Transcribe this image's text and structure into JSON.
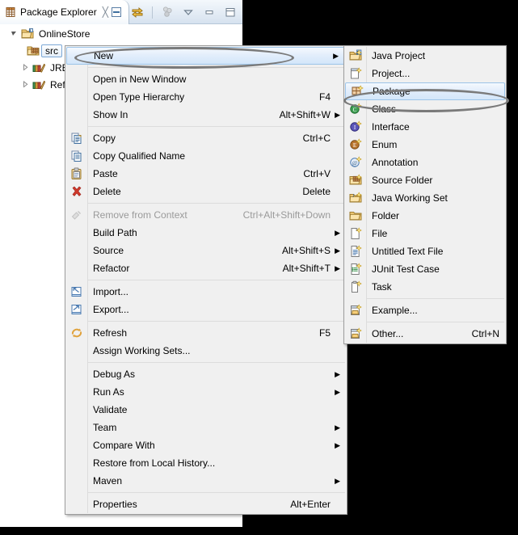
{
  "view": {
    "tab": {
      "title": "Package Explorer",
      "icon": "package-explorer-icon",
      "close": "╳"
    },
    "toolbar": [
      {
        "name": "collapse-all-icon",
        "title": "Collapse All"
      },
      {
        "name": "link-with-editor-icon",
        "title": "Link with Editor"
      },
      {
        "name": "view-menu-icon",
        "title": "View Menu"
      },
      {
        "name": "chevron-down-icon",
        "title": "Minimize Group"
      },
      {
        "name": "minimize-icon",
        "title": "Minimize"
      },
      {
        "name": "maximize-icon",
        "title": "Maximize"
      }
    ],
    "tree": [
      {
        "label": "OnlineStore",
        "icon": "java-project-icon",
        "depth": 0,
        "expanded": true,
        "selected": false
      },
      {
        "label": "src",
        "icon": "source-folder-icon",
        "depth": 1,
        "expanded": null,
        "selected": true
      },
      {
        "label": "JRE",
        "icon": "library-icon",
        "depth": 1,
        "expanded": false,
        "selected": false
      },
      {
        "label": "Ref",
        "icon": "library-icon",
        "depth": 1,
        "expanded": false,
        "selected": false
      }
    ]
  },
  "context_menu": {
    "items": [
      {
        "label": "New",
        "accel": "",
        "icon": "",
        "arrow": true,
        "highlighted": true,
        "disabled": false
      },
      {
        "separator": true
      },
      {
        "label": "Open in New Window",
        "accel": "",
        "icon": "",
        "arrow": false,
        "highlighted": false,
        "disabled": false
      },
      {
        "label": "Open Type Hierarchy",
        "accel": "F4",
        "icon": "",
        "arrow": false,
        "highlighted": false,
        "disabled": false
      },
      {
        "label": "Show In",
        "accel": "Alt+Shift+W",
        "icon": "",
        "arrow": true,
        "highlighted": false,
        "disabled": false
      },
      {
        "separator": true
      },
      {
        "label": "Copy",
        "accel": "Ctrl+C",
        "icon": "copy-icon",
        "arrow": false,
        "highlighted": false,
        "disabled": false
      },
      {
        "label": "Copy Qualified Name",
        "accel": "",
        "icon": "copy-qualified-name-icon",
        "arrow": false,
        "highlighted": false,
        "disabled": false
      },
      {
        "label": "Paste",
        "accel": "Ctrl+V",
        "icon": "paste-icon",
        "arrow": false,
        "highlighted": false,
        "disabled": false
      },
      {
        "label": "Delete",
        "accel": "Delete",
        "icon": "delete-icon",
        "arrow": false,
        "highlighted": false,
        "disabled": false
      },
      {
        "separator": true
      },
      {
        "label": "Remove from Context",
        "accel": "Ctrl+Alt+Shift+Down",
        "icon": "remove-from-context-icon",
        "arrow": false,
        "highlighted": false,
        "disabled": true
      },
      {
        "label": "Build Path",
        "accel": "",
        "icon": "",
        "arrow": true,
        "highlighted": false,
        "disabled": false
      },
      {
        "label": "Source",
        "accel": "Alt+Shift+S",
        "icon": "",
        "arrow": true,
        "highlighted": false,
        "disabled": false
      },
      {
        "label": "Refactor",
        "accel": "Alt+Shift+T",
        "icon": "",
        "arrow": true,
        "highlighted": false,
        "disabled": false
      },
      {
        "separator": true
      },
      {
        "label": "Import...",
        "accel": "",
        "icon": "import-icon",
        "arrow": false,
        "highlighted": false,
        "disabled": false
      },
      {
        "label": "Export...",
        "accel": "",
        "icon": "export-icon",
        "arrow": false,
        "highlighted": false,
        "disabled": false
      },
      {
        "separator": true
      },
      {
        "label": "Refresh",
        "accel": "F5",
        "icon": "refresh-icon",
        "arrow": false,
        "highlighted": false,
        "disabled": false
      },
      {
        "label": "Assign Working Sets...",
        "accel": "",
        "icon": "",
        "arrow": false,
        "highlighted": false,
        "disabled": false
      },
      {
        "separator": true
      },
      {
        "label": "Debug As",
        "accel": "",
        "icon": "",
        "arrow": true,
        "highlighted": false,
        "disabled": false
      },
      {
        "label": "Run As",
        "accel": "",
        "icon": "",
        "arrow": true,
        "highlighted": false,
        "disabled": false
      },
      {
        "label": "Validate",
        "accel": "",
        "icon": "",
        "arrow": false,
        "highlighted": false,
        "disabled": false
      },
      {
        "label": "Team",
        "accel": "",
        "icon": "",
        "arrow": true,
        "highlighted": false,
        "disabled": false
      },
      {
        "label": "Compare With",
        "accel": "",
        "icon": "",
        "arrow": true,
        "highlighted": false,
        "disabled": false
      },
      {
        "label": "Restore from Local History...",
        "accel": "",
        "icon": "",
        "arrow": false,
        "highlighted": false,
        "disabled": false
      },
      {
        "label": "Maven",
        "accel": "",
        "icon": "",
        "arrow": true,
        "highlighted": false,
        "disabled": false
      },
      {
        "separator": true
      },
      {
        "label": "Properties",
        "accel": "Alt+Enter",
        "icon": "",
        "arrow": false,
        "highlighted": false,
        "disabled": false
      }
    ]
  },
  "new_submenu": {
    "items": [
      {
        "label": "Java Project",
        "accel": "",
        "icon": "java-project-icon",
        "highlighted": false
      },
      {
        "label": "Project...",
        "accel": "",
        "icon": "project-icon",
        "highlighted": false
      },
      {
        "label": "Package",
        "accel": "",
        "icon": "package-icon",
        "highlighted": true
      },
      {
        "label": "Class",
        "accel": "",
        "icon": "class-icon",
        "highlighted": false
      },
      {
        "label": "Interface",
        "accel": "",
        "icon": "interface-icon",
        "highlighted": false
      },
      {
        "label": "Enum",
        "accel": "",
        "icon": "enum-icon",
        "highlighted": false
      },
      {
        "label": "Annotation",
        "accel": "",
        "icon": "annotation-icon",
        "highlighted": false
      },
      {
        "label": "Source Folder",
        "accel": "",
        "icon": "source-folder-icon",
        "highlighted": false
      },
      {
        "label": "Java Working Set",
        "accel": "",
        "icon": "java-working-set-icon",
        "highlighted": false
      },
      {
        "label": "Folder",
        "accel": "",
        "icon": "folder-icon",
        "highlighted": false
      },
      {
        "label": "File",
        "accel": "",
        "icon": "file-icon",
        "highlighted": false
      },
      {
        "label": "Untitled Text File",
        "accel": "",
        "icon": "text-file-icon",
        "highlighted": false
      },
      {
        "label": "JUnit Test Case",
        "accel": "",
        "icon": "junit-test-case-icon",
        "highlighted": false
      },
      {
        "label": "Task",
        "accel": "",
        "icon": "task-icon",
        "highlighted": false
      },
      {
        "separator": true
      },
      {
        "label": "Example...",
        "accel": "",
        "icon": "example-icon",
        "highlighted": false
      },
      {
        "separator": true
      },
      {
        "label": "Other...",
        "accel": "Ctrl+N",
        "icon": "other-icon",
        "highlighted": false
      }
    ]
  },
  "annotations": [
    {
      "name": "highlight-oval-new",
      "target": "New"
    },
    {
      "name": "highlight-oval-package",
      "target": "Package"
    }
  ],
  "colors": {
    "menu_bg": "#f0f0f0",
    "menu_border": "#9d9d9d",
    "highlight_border": "#9cc4e8",
    "annotation": "#7a7a7a",
    "disabled_text": "#9a9a9a",
    "backdrop": "#000000"
  }
}
